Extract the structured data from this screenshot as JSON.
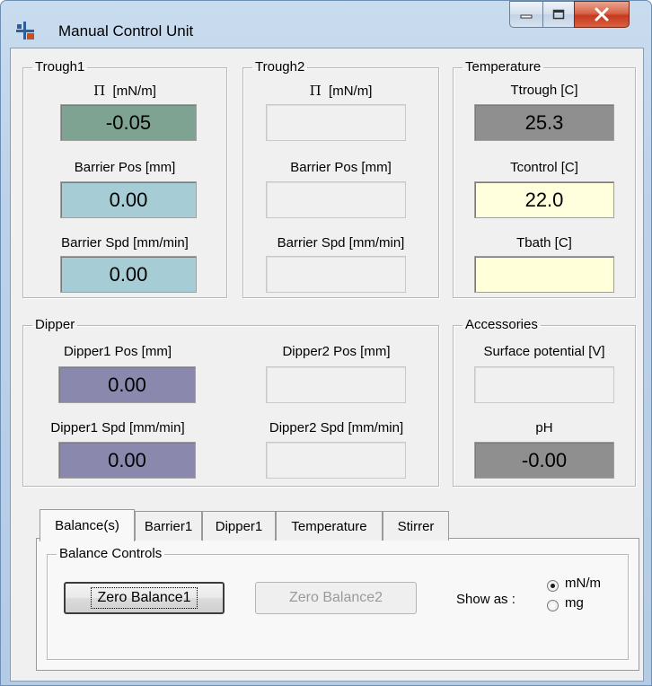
{
  "window": {
    "title": "Manual Control Unit"
  },
  "trough1": {
    "legend": "Trough1",
    "pi_label": "[mN/m]",
    "pi_symbol": "Π",
    "pi_value": "-0.05",
    "barrier_pos_label": "Barrier Pos [mm]",
    "barrier_pos_value": "0.00",
    "barrier_spd_label": "Barrier Spd [mm/min]",
    "barrier_spd_value": "0.00"
  },
  "trough2": {
    "legend": "Trough2",
    "pi_label": "[mN/m]",
    "pi_symbol": "Π",
    "pi_value": "",
    "barrier_pos_label": "Barrier Pos [mm]",
    "barrier_pos_value": "",
    "barrier_spd_label": "Barrier Spd [mm/min]",
    "barrier_spd_value": ""
  },
  "temperature": {
    "legend": "Temperature",
    "ttrough_label": "Ttrough [C]",
    "ttrough_value": "25.3",
    "tcontrol_label": "Tcontrol [C]",
    "tcontrol_value": "22.0",
    "tbath_label": "Tbath [C]",
    "tbath_value": ""
  },
  "dipper": {
    "legend": "Dipper",
    "d1_pos_label": "Dipper1 Pos [mm]",
    "d1_pos_value": "0.00",
    "d2_pos_label": "Dipper2 Pos [mm]",
    "d2_pos_value": "",
    "d1_spd_label": "Dipper1 Spd [mm/min]",
    "d1_spd_value": "0.00",
    "d2_spd_label": "Dipper2 Spd [mm/min]",
    "d2_spd_value": ""
  },
  "accessories": {
    "legend": "Accessories",
    "surface_label": "Surface potential [V]",
    "surface_value": "",
    "ph_label": "pH",
    "ph_value": "-0.00"
  },
  "tabs": [
    "Balance(s)",
    "Barrier1",
    "Dipper1",
    "Temperature",
    "Stirrer"
  ],
  "balance": {
    "legend": "Balance Controls",
    "zero1": "Zero Balance1",
    "zero2": "Zero Balance2",
    "show_as": "Show as :",
    "opt_mnm": "mN/m",
    "opt_mg": "mg",
    "selected": "mN/m"
  },
  "colors": {
    "pi_box": "#7fa392",
    "barrier_box": "#a6cdd6",
    "ttrough_box": "#8f8f8f",
    "tcontrol_box": "#ffffdd",
    "tbath_box": "#ffffd9",
    "dipper_box": "#8a88ad",
    "ph_box": "#8f8f8f"
  },
  "icons": {
    "app": "lab-balance-icon",
    "minimize": "minimize-icon",
    "maximize": "maximize-icon",
    "close": "close-icon"
  }
}
